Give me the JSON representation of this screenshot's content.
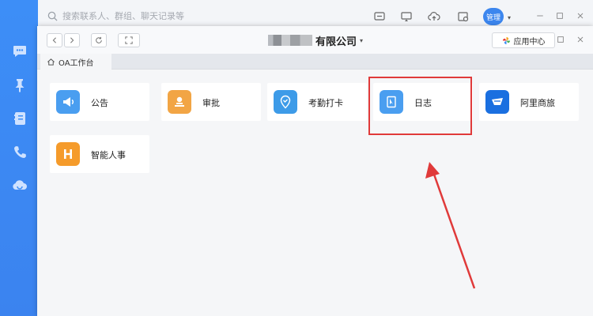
{
  "search": {
    "placeholder": "搜索联系人、群组、聊天记录等"
  },
  "user": {
    "avatar_text": "管理"
  },
  "company": {
    "name": "有限公司"
  },
  "app_center": {
    "label": "应用中心"
  },
  "tab": {
    "label": "OA工作台"
  },
  "apps": [
    {
      "label": "公告",
      "icon": "megaphone-icon",
      "color": "#4a9ef0"
    },
    {
      "label": "审批",
      "icon": "person-stamp-icon",
      "color": "#f2a545"
    },
    {
      "label": "考勤打卡",
      "icon": "location-pin-icon",
      "color": "#3d9be8"
    },
    {
      "label": "日志",
      "icon": "notebook-icon",
      "color": "#4a9ef0"
    },
    {
      "label": "阿里商旅",
      "icon": "alitrip-logo-icon",
      "color": "#1a6fe0"
    },
    {
      "label": "智能人事",
      "icon": "h-logo-icon",
      "color": "#f59b2b"
    }
  ],
  "colors": {
    "rail": "#3d8ef7",
    "highlight": "#e03a3a"
  }
}
